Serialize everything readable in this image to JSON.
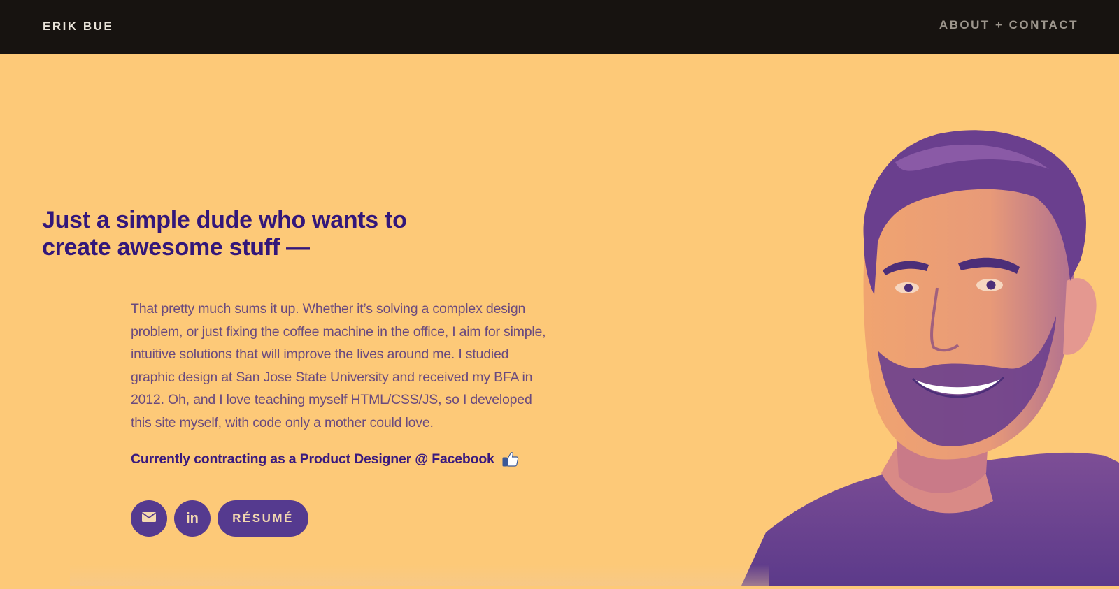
{
  "nav": {
    "brand": "ERIK BUE",
    "about_contact": "ABOUT + CONTACT"
  },
  "hero": {
    "headline_line1": "Just a simple dude who wants to",
    "headline_line2": "create awesome stuff —",
    "bio": "That pretty much sums it up. Whether it’s solving a complex design problem, or just fixing the coffee machine in the office, I aim for simple, intuitive solutions that will improve the lives around me. I studied graphic design at San Jose State University and received my BFA in 2012. Oh, and I love teaching myself HTML/CSS/JS, so I developed this site myself, with code only a mother could love.",
    "status": "Currently contracting as a Product Designer @ Facebook",
    "status_icon": "thumbs-up-icon",
    "buttons": {
      "email_icon": "envelope-icon",
      "linkedin_icon": "linkedin-icon",
      "linkedin_glyph": "in",
      "resume_label": "RÉSUMÉ"
    }
  },
  "colors": {
    "background": "#FDC978",
    "navbar": "#171310",
    "headline": "#33177A",
    "body_text": "#6A4A7E",
    "button": "#553A8F"
  }
}
